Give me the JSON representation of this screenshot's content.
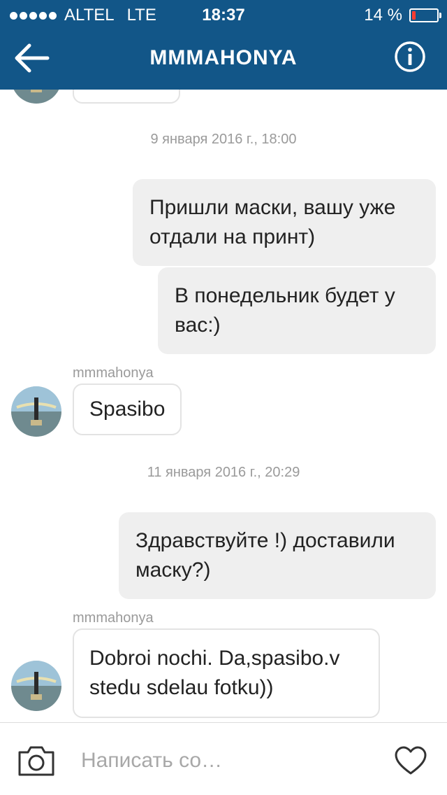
{
  "status_bar": {
    "carrier": "ALTEL",
    "network": "LTE",
    "time": "18:37",
    "battery_percent": "14 %",
    "battery_level": 0.14
  },
  "header": {
    "title": "MMMAHONYA"
  },
  "messages": {
    "date_1": "9 января 2016 г., 18:00",
    "out_1": "Пришли маски, вашу уже отдали на принт)",
    "out_2": "В понедельник будет у вас:)",
    "sender_1": "mmmahonya",
    "in_1": "Spasibo",
    "date_2": "11 января 2016 г., 20:29",
    "out_3": "Здравствуйте !) доставили маску?)",
    "sender_2": "mmmahonya",
    "in_2": "Dobroi nochi. Da,spasibo.v stedu sdelau fotku))"
  },
  "composer": {
    "placeholder": "Написать со…"
  },
  "colors": {
    "header_bg": "#125688",
    "bubble_out_bg": "#efefef",
    "bubble_in_border": "#e3e3e3",
    "battery_low": "#ff3b30"
  },
  "icons": {
    "back": "back-arrow-icon",
    "info": "info-icon",
    "camera": "camera-icon",
    "like": "heart-icon"
  }
}
